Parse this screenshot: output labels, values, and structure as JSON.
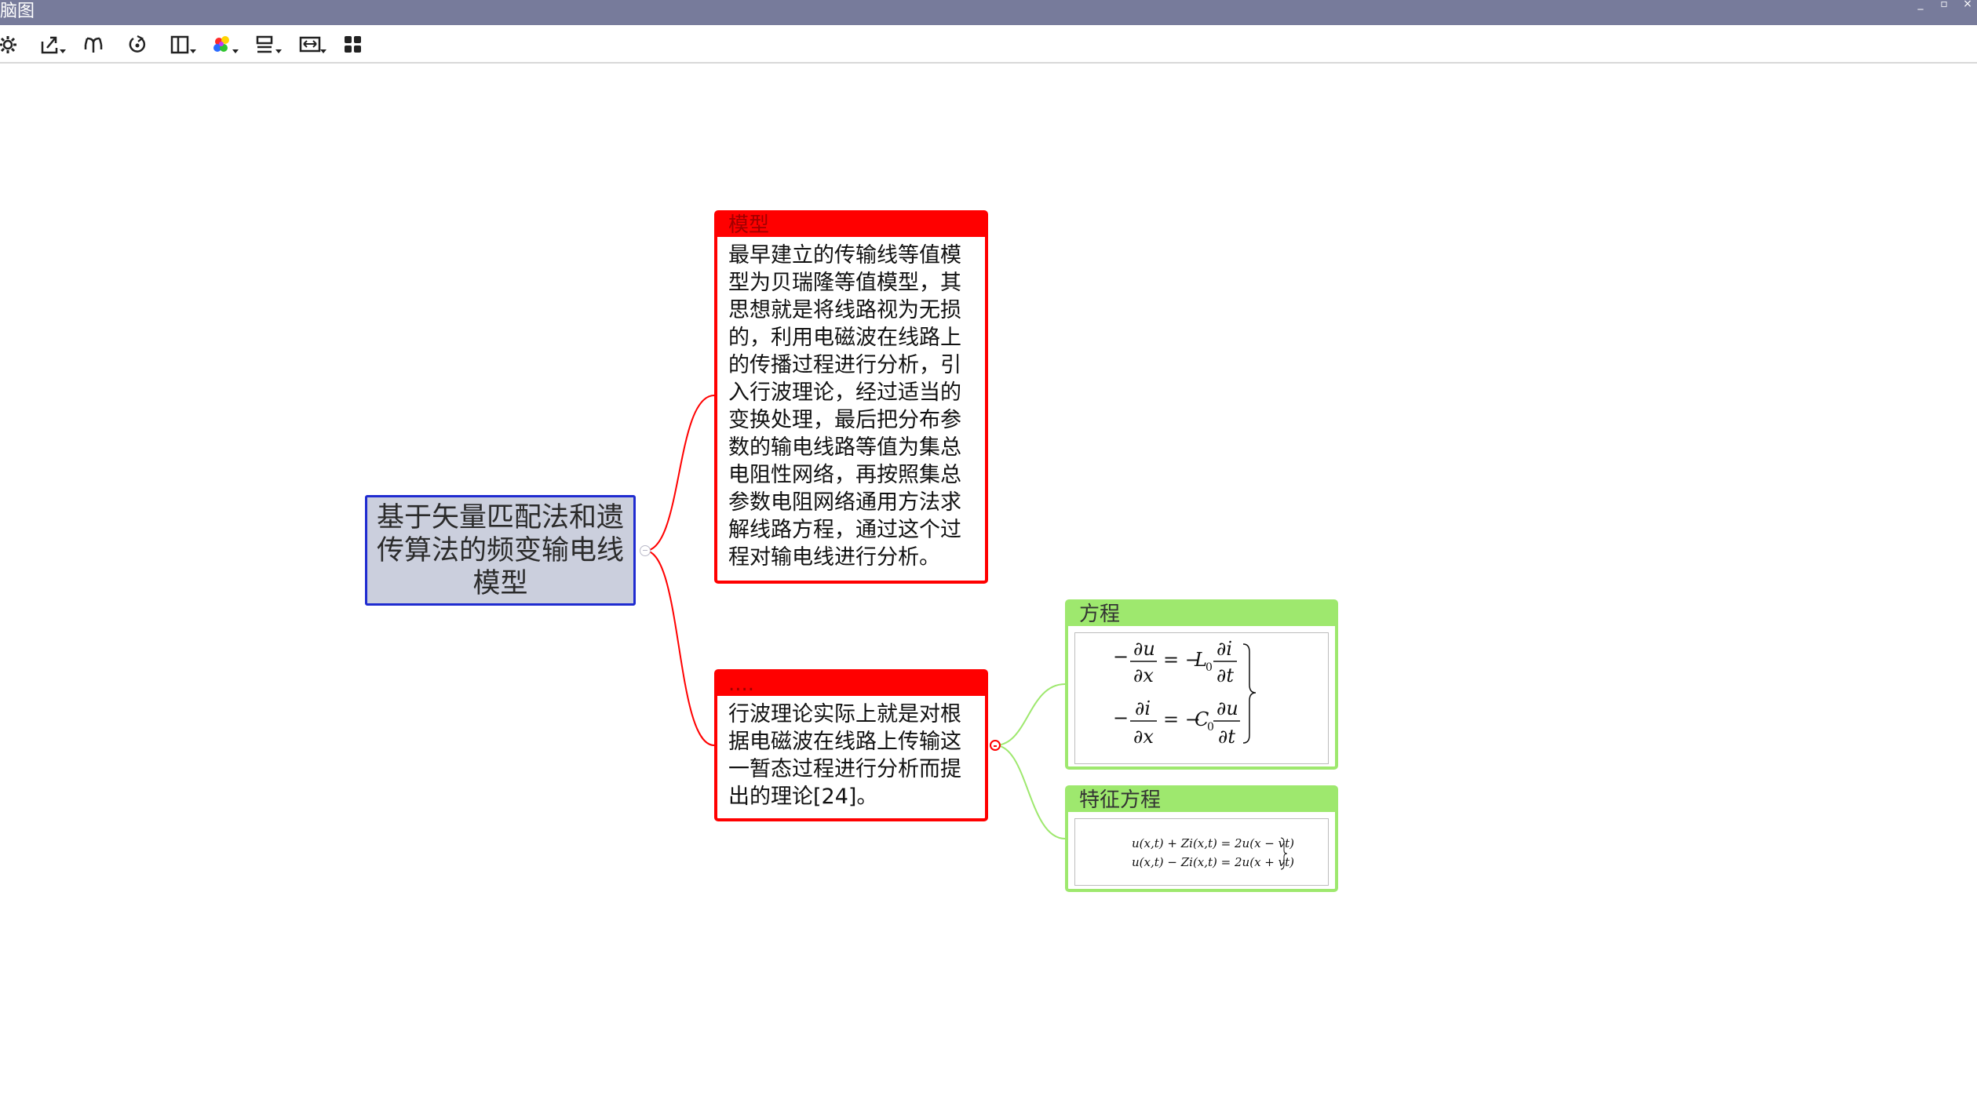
{
  "window": {
    "title": "脑图",
    "minimize": "_",
    "restore": "▫",
    "close": "×"
  },
  "toolbar": {
    "buttons": [
      {
        "name": "settings",
        "icon": "gear-icon"
      },
      {
        "name": "export",
        "icon": "export-dropdown-icon"
      },
      {
        "name": "layout",
        "icon": "branch-layout-icon"
      },
      {
        "name": "refresh",
        "icon": "rotate-icon"
      },
      {
        "name": "columns",
        "icon": "columns-dropdown-icon"
      },
      {
        "name": "theme-colors",
        "icon": "color-palette-dropdown-icon"
      },
      {
        "name": "align",
        "icon": "align-dropdown-icon"
      },
      {
        "name": "fit-width",
        "icon": "fit-width-dropdown-icon"
      },
      {
        "name": "grid-view",
        "icon": "grid-icon"
      }
    ]
  },
  "mindmap": {
    "root": "基于矢量匹配法和遗传算法的频变输电线模型",
    "branches": [
      {
        "title": "模型",
        "body": "最早建立的传输线等值模型为贝瑞隆等值模型，其思想就是将线路视为无损的，利用电磁波在线路上的传播过程进行分析，引入行波理论，经过适当的变换处理，最后把分布参数的输电线路等值为集总电阻性网络，再按照集总参数电阻网络通用方法求解线路方程，通过这个过程对输电线进行分析。"
      },
      {
        "title": "....",
        "body": "行波理论实际上就是对根据电磁波在线路上传输这一暂态过程进行分析而提出的理论[24]。",
        "children": [
          {
            "title": "方程",
            "formula": [
              "−∂u/∂x = −L₀ ∂i/∂t",
              "−∂i/∂x = −C₀ ∂u/∂t"
            ]
          },
          {
            "title": "特征方程",
            "formula": [
              "u(x,t) + Zi(x,t) = 2u(x − vt)",
              "u(x,t) − Zi(x,t) = 2u(x + vt)"
            ]
          }
        ]
      }
    ]
  },
  "colors": {
    "titlebar": "#777b9b",
    "root_fill": "#cbcfdd",
    "root_border": "#1f2bd0",
    "branch_red": "#ff0000",
    "branch_green": "#9ee86e"
  }
}
